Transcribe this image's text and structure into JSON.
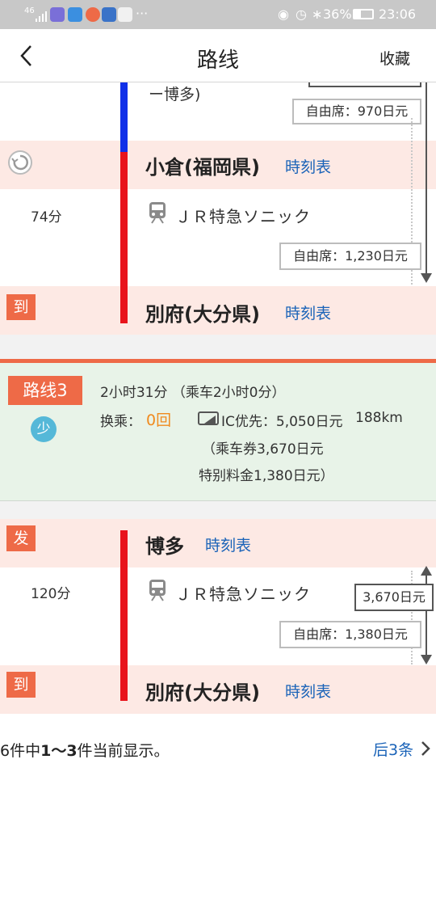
{
  "status_bar": {
    "signal": "46",
    "battery": "36%",
    "time": "23:06",
    "more": "···"
  },
  "nav": {
    "back_icon": "chevron-left-icon",
    "title": "路线",
    "favorite": "收藏"
  },
  "route2": {
    "prev_line_tail": "ー博多)",
    "prev_fare": "自由席：970日元",
    "transfer_station": "小倉(福岡県)",
    "transfer_timetable": "時刻表",
    "duration": "74分",
    "train": "ＪＲ特急ソニック",
    "fare": "自由席：1,230日元",
    "arrive_tag": "到",
    "arrive_station": "別府(大分県)",
    "arrive_timetable": "時刻表"
  },
  "route3": {
    "label": "路线3",
    "badge": "少",
    "time_summary": "2小时31分 （乘车2小时0分）",
    "transfer_label": "换乘：",
    "transfer_count": "0回",
    "ic_priority": "IC优先：5,050日元",
    "distance": "188km",
    "ticket": "（乘车券3,670日元",
    "special": "特别料金1,380日元）",
    "depart_tag": "发",
    "depart_station": "博多",
    "depart_timetable": "時刻表",
    "duration": "120分",
    "train": "ＪＲ特急ソニック",
    "ticket_fare": "3,670日元",
    "fare": "自由席：1,380日元",
    "arrive_tag": "到",
    "arrive_station": "別府(大分県)",
    "arrive_timetable": "時刻表"
  },
  "pagination": {
    "summary_prefix": "6件中",
    "summary_range": "1〜3",
    "summary_suffix": "件当前显示。",
    "next": "后3条"
  },
  "colors": {
    "accent": "#ee6a47",
    "rail_red": "#e8141c",
    "rail_blue": "#1030e8",
    "link": "#1a63b8",
    "pink": "#fde9e4",
    "green": "#e8f3e8"
  }
}
